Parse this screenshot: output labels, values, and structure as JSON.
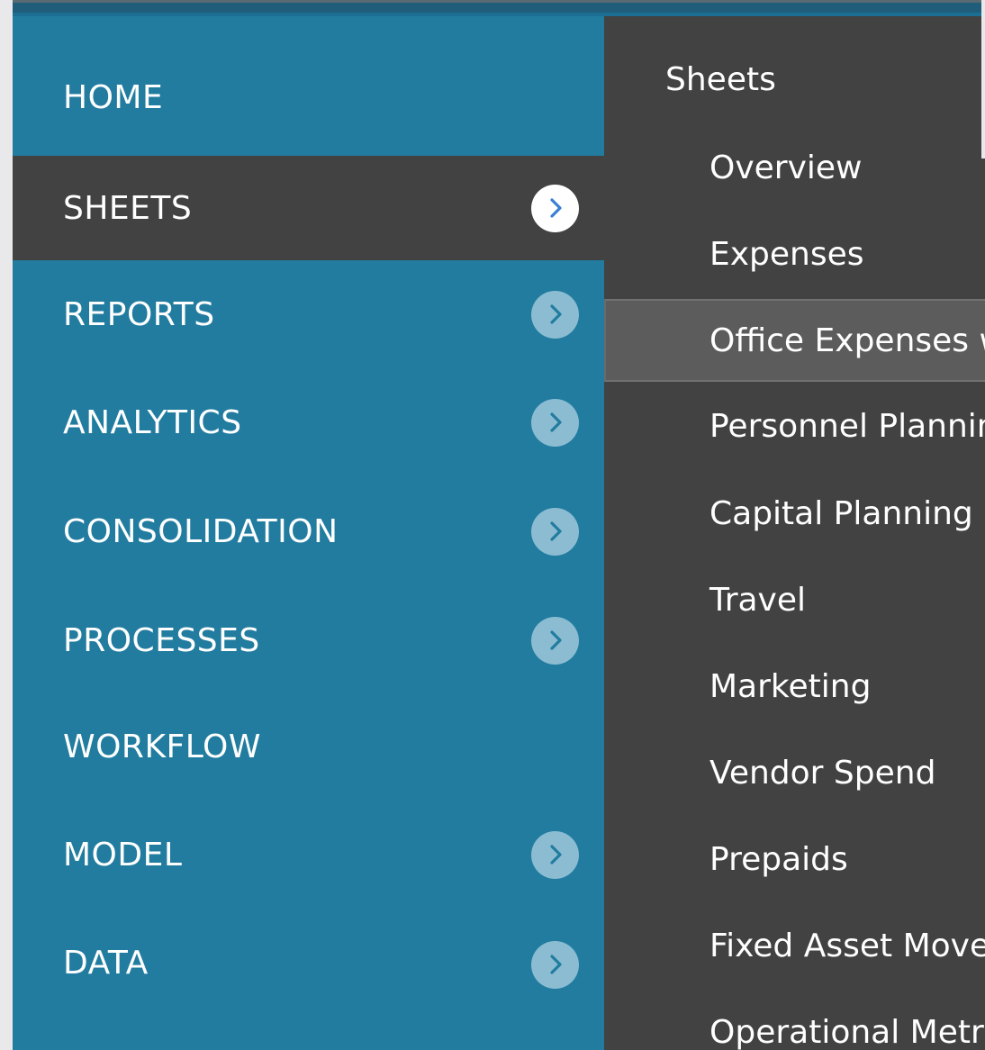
{
  "colors": {
    "nav_bg": "#217c9f",
    "nav_active_bg": "#424242",
    "submenu_bg": "#424242",
    "submenu_active_bg": "#5c5c5c",
    "chevron_bg": "#8bbcd2",
    "chevron_active_bg": "#ffffff",
    "chevron_active_icon": "#3a7fd0"
  },
  "nav": {
    "items": [
      {
        "label": "HOME",
        "has_chevron": false,
        "active": false
      },
      {
        "label": "SHEETS",
        "has_chevron": true,
        "active": true
      },
      {
        "label": "REPORTS",
        "has_chevron": true,
        "active": false
      },
      {
        "label": "ANALYTICS",
        "has_chevron": true,
        "active": false
      },
      {
        "label": "CONSOLIDATION",
        "has_chevron": true,
        "active": false
      },
      {
        "label": "PROCESSES",
        "has_chevron": true,
        "active": false
      },
      {
        "label": "WORKFLOW",
        "has_chevron": false,
        "active": false
      },
      {
        "label": "MODEL",
        "has_chevron": true,
        "active": false
      },
      {
        "label": "DATA",
        "has_chevron": true,
        "active": false
      }
    ]
  },
  "submenu": {
    "title": "Sheets",
    "items": [
      {
        "label": "Overview",
        "active": false
      },
      {
        "label": "Expenses",
        "active": false
      },
      {
        "label": "Office Expenses w",
        "active": true
      },
      {
        "label": "Personnel Plannin",
        "active": false
      },
      {
        "label": "Capital Planning",
        "active": false
      },
      {
        "label": "Travel",
        "active": false
      },
      {
        "label": "Marketing",
        "active": false
      },
      {
        "label": "Vendor Spend",
        "active": false
      },
      {
        "label": "Prepaids",
        "active": false
      },
      {
        "label": "Fixed Asset Mover",
        "active": false
      },
      {
        "label": "Operational Metri",
        "active": false
      }
    ]
  }
}
